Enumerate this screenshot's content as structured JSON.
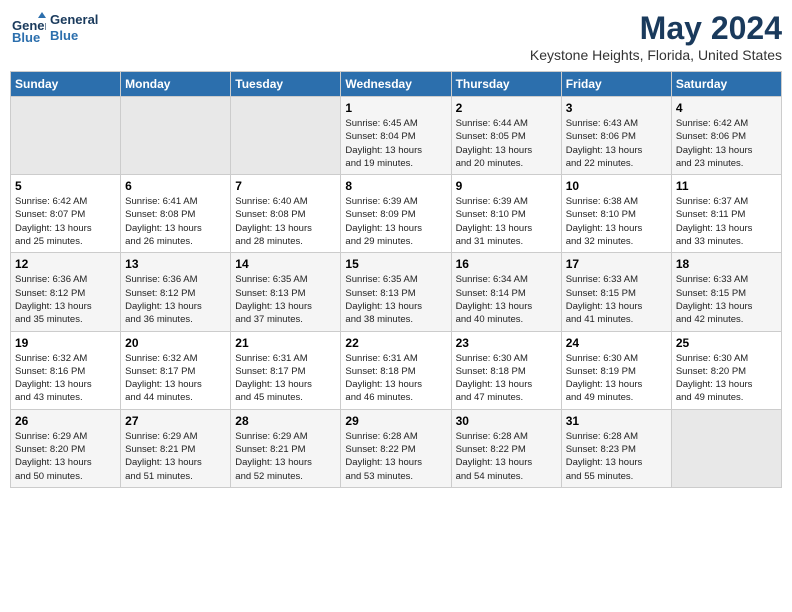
{
  "logo": {
    "line1": "General",
    "line2": "Blue"
  },
  "title": "May 2024",
  "location": "Keystone Heights, Florida, United States",
  "days_of_week": [
    "Sunday",
    "Monday",
    "Tuesday",
    "Wednesday",
    "Thursday",
    "Friday",
    "Saturday"
  ],
  "weeks": [
    [
      {
        "day": "",
        "info": ""
      },
      {
        "day": "",
        "info": ""
      },
      {
        "day": "",
        "info": ""
      },
      {
        "day": "1",
        "info": "Sunrise: 6:45 AM\nSunset: 8:04 PM\nDaylight: 13 hours\nand 19 minutes."
      },
      {
        "day": "2",
        "info": "Sunrise: 6:44 AM\nSunset: 8:05 PM\nDaylight: 13 hours\nand 20 minutes."
      },
      {
        "day": "3",
        "info": "Sunrise: 6:43 AM\nSunset: 8:06 PM\nDaylight: 13 hours\nand 22 minutes."
      },
      {
        "day": "4",
        "info": "Sunrise: 6:42 AM\nSunset: 8:06 PM\nDaylight: 13 hours\nand 23 minutes."
      }
    ],
    [
      {
        "day": "5",
        "info": "Sunrise: 6:42 AM\nSunset: 8:07 PM\nDaylight: 13 hours\nand 25 minutes."
      },
      {
        "day": "6",
        "info": "Sunrise: 6:41 AM\nSunset: 8:08 PM\nDaylight: 13 hours\nand 26 minutes."
      },
      {
        "day": "7",
        "info": "Sunrise: 6:40 AM\nSunset: 8:08 PM\nDaylight: 13 hours\nand 28 minutes."
      },
      {
        "day": "8",
        "info": "Sunrise: 6:39 AM\nSunset: 8:09 PM\nDaylight: 13 hours\nand 29 minutes."
      },
      {
        "day": "9",
        "info": "Sunrise: 6:39 AM\nSunset: 8:10 PM\nDaylight: 13 hours\nand 31 minutes."
      },
      {
        "day": "10",
        "info": "Sunrise: 6:38 AM\nSunset: 8:10 PM\nDaylight: 13 hours\nand 32 minutes."
      },
      {
        "day": "11",
        "info": "Sunrise: 6:37 AM\nSunset: 8:11 PM\nDaylight: 13 hours\nand 33 minutes."
      }
    ],
    [
      {
        "day": "12",
        "info": "Sunrise: 6:36 AM\nSunset: 8:12 PM\nDaylight: 13 hours\nand 35 minutes."
      },
      {
        "day": "13",
        "info": "Sunrise: 6:36 AM\nSunset: 8:12 PM\nDaylight: 13 hours\nand 36 minutes."
      },
      {
        "day": "14",
        "info": "Sunrise: 6:35 AM\nSunset: 8:13 PM\nDaylight: 13 hours\nand 37 minutes."
      },
      {
        "day": "15",
        "info": "Sunrise: 6:35 AM\nSunset: 8:13 PM\nDaylight: 13 hours\nand 38 minutes."
      },
      {
        "day": "16",
        "info": "Sunrise: 6:34 AM\nSunset: 8:14 PM\nDaylight: 13 hours\nand 40 minutes."
      },
      {
        "day": "17",
        "info": "Sunrise: 6:33 AM\nSunset: 8:15 PM\nDaylight: 13 hours\nand 41 minutes."
      },
      {
        "day": "18",
        "info": "Sunrise: 6:33 AM\nSunset: 8:15 PM\nDaylight: 13 hours\nand 42 minutes."
      }
    ],
    [
      {
        "day": "19",
        "info": "Sunrise: 6:32 AM\nSunset: 8:16 PM\nDaylight: 13 hours\nand 43 minutes."
      },
      {
        "day": "20",
        "info": "Sunrise: 6:32 AM\nSunset: 8:17 PM\nDaylight: 13 hours\nand 44 minutes."
      },
      {
        "day": "21",
        "info": "Sunrise: 6:31 AM\nSunset: 8:17 PM\nDaylight: 13 hours\nand 45 minutes."
      },
      {
        "day": "22",
        "info": "Sunrise: 6:31 AM\nSunset: 8:18 PM\nDaylight: 13 hours\nand 46 minutes."
      },
      {
        "day": "23",
        "info": "Sunrise: 6:30 AM\nSunset: 8:18 PM\nDaylight: 13 hours\nand 47 minutes."
      },
      {
        "day": "24",
        "info": "Sunrise: 6:30 AM\nSunset: 8:19 PM\nDaylight: 13 hours\nand 49 minutes."
      },
      {
        "day": "25",
        "info": "Sunrise: 6:30 AM\nSunset: 8:20 PM\nDaylight: 13 hours\nand 49 minutes."
      }
    ],
    [
      {
        "day": "26",
        "info": "Sunrise: 6:29 AM\nSunset: 8:20 PM\nDaylight: 13 hours\nand 50 minutes."
      },
      {
        "day": "27",
        "info": "Sunrise: 6:29 AM\nSunset: 8:21 PM\nDaylight: 13 hours\nand 51 minutes."
      },
      {
        "day": "28",
        "info": "Sunrise: 6:29 AM\nSunset: 8:21 PM\nDaylight: 13 hours\nand 52 minutes."
      },
      {
        "day": "29",
        "info": "Sunrise: 6:28 AM\nSunset: 8:22 PM\nDaylight: 13 hours\nand 53 minutes."
      },
      {
        "day": "30",
        "info": "Sunrise: 6:28 AM\nSunset: 8:22 PM\nDaylight: 13 hours\nand 54 minutes."
      },
      {
        "day": "31",
        "info": "Sunrise: 6:28 AM\nSunset: 8:23 PM\nDaylight: 13 hours\nand 55 minutes."
      },
      {
        "day": "",
        "info": ""
      }
    ]
  ]
}
